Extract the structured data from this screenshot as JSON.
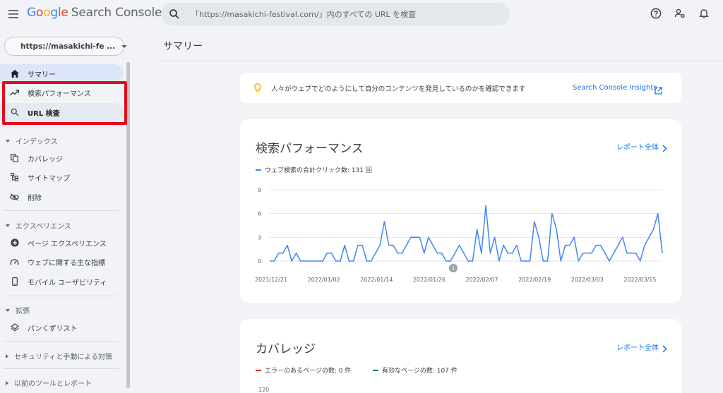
{
  "app": {
    "logo_letters": [
      "G",
      "o",
      "o",
      "g",
      "l",
      "e"
    ],
    "product": "Search Console"
  },
  "search": {
    "placeholder": "「https://masakichi-festival.com/」内のすべての URL を検査"
  },
  "property": {
    "label": "https://masakichi-fe ..."
  },
  "sidebar": {
    "items": [
      {
        "label": "サマリー",
        "icon": "home-icon"
      },
      {
        "label": "検索パフォーマンス",
        "icon": "trending-up-icon"
      },
      {
        "label": "URL 検査",
        "icon": "search-icon"
      },
      {
        "label": "カバレッジ",
        "icon": "copy-icon"
      },
      {
        "label": "サイトマップ",
        "icon": "sitemap-icon"
      },
      {
        "label": "削除",
        "icon": "visibility-off-icon"
      },
      {
        "label": "ページ エクスペリエンス",
        "icon": "add-circle-icon"
      },
      {
        "label": "ウェブに関する主な指標",
        "icon": "speed-icon"
      },
      {
        "label": "モバイル ユーザビリティ",
        "icon": "smartphone-icon"
      },
      {
        "label": "パンくずリスト",
        "icon": "layers-icon"
      }
    ],
    "sections": {
      "index": "インデックス",
      "experience": "エクスペリエンス",
      "enhancements": "拡張",
      "security": "セキュリティと手動による対策",
      "legacy": "以前のツールとレポート"
    }
  },
  "main": {
    "title": "サマリー",
    "insight_text": "人々がウェブでどのようにして自分のコンテンツを発見しているのかを確認できます",
    "insight_link": "Search Console Insights",
    "performance": {
      "title": "検索パフォーマンス",
      "report_link": "レポート全体",
      "legend": "ウェブ検索の合計クリック数: 131 回",
      "annotation": "1"
    },
    "coverage": {
      "title": "カバレッジ",
      "report_link": "レポート全体",
      "legend_error": "エラーのあるページの数: 0 件",
      "legend_valid": "有効なページの数: 107 件",
      "y_top": "120"
    }
  },
  "colors": {
    "accent": "#1a73e8",
    "line": "#4285f4",
    "error": "#d93025",
    "valid": "#188038",
    "callout": "#e8071a"
  },
  "chart_data": {
    "type": "line",
    "title": "検索パフォーマンス",
    "series": [
      {
        "name": "ウェブ検索の合計クリック数: 131 回",
        "values": [
          0,
          0,
          1,
          1,
          2,
          0,
          1,
          0,
          0,
          0,
          0,
          0,
          0,
          1,
          1,
          0,
          0,
          2,
          0,
          0,
          2,
          2,
          0,
          0,
          1,
          2,
          5,
          2,
          2,
          1,
          1,
          2,
          3,
          3,
          3,
          1,
          3,
          2,
          1,
          1,
          0,
          0,
          1,
          2,
          1,
          0,
          0,
          4,
          1,
          7,
          1,
          3,
          0,
          2,
          1,
          1,
          2,
          0,
          0,
          0,
          5,
          3,
          0,
          0,
          6,
          4,
          0,
          2,
          2,
          3,
          0,
          1,
          1,
          1,
          2,
          2,
          1,
          0,
          1,
          2,
          3,
          1,
          1,
          1,
          0,
          2,
          3,
          4,
          6,
          1
        ]
      }
    ],
    "x_ticks": [
      "2021/12/21",
      "2022/01/02",
      "2022/01/14",
      "2022/01/26",
      "2022/02/07",
      "2022/02/19",
      "2022/03/03",
      "2022/03/15"
    ],
    "y_ticks": [
      "0",
      "3",
      "6",
      "9"
    ],
    "ylim": [
      0,
      9
    ],
    "grid": true
  }
}
